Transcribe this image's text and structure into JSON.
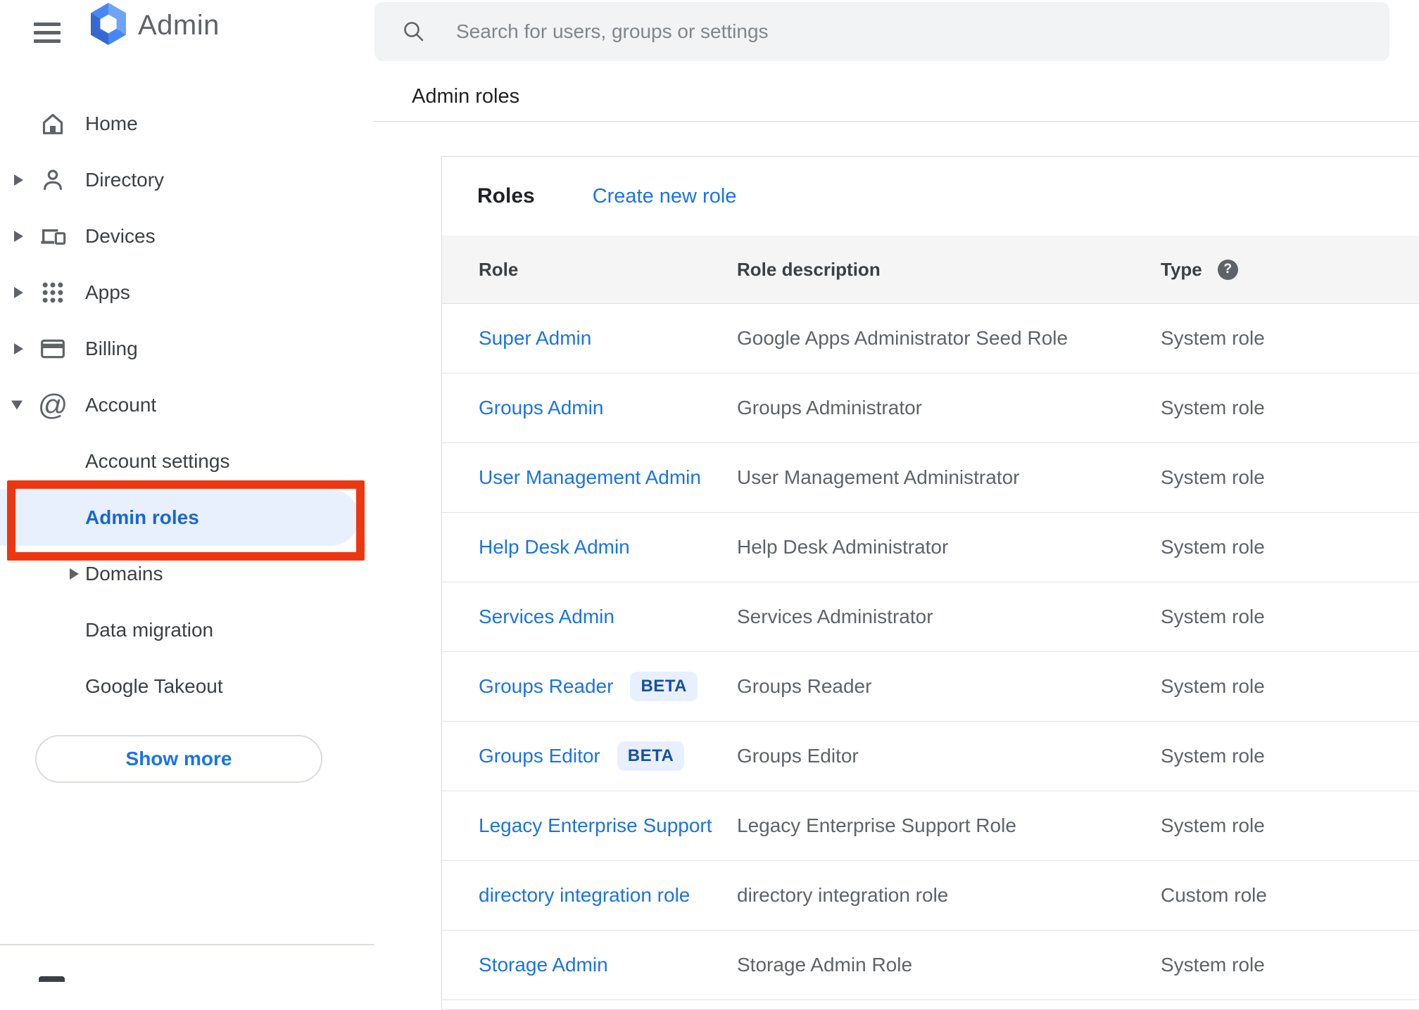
{
  "app": {
    "product_name": "Admin"
  },
  "search": {
    "placeholder": "Search for users, groups or settings"
  },
  "breadcrumb": {
    "label": "Admin roles"
  },
  "sidebar": {
    "items": [
      {
        "label": "Home",
        "icon": "home",
        "arrow": "none",
        "level": 0,
        "active": false
      },
      {
        "label": "Directory",
        "icon": "person",
        "arrow": "right",
        "level": 0,
        "active": false
      },
      {
        "label": "Devices",
        "icon": "devices",
        "arrow": "right",
        "level": 0,
        "active": false
      },
      {
        "label": "Apps",
        "icon": "apps",
        "arrow": "right",
        "level": 0,
        "active": false
      },
      {
        "label": "Billing",
        "icon": "card",
        "arrow": "right",
        "level": 0,
        "active": false
      },
      {
        "label": "Account",
        "icon": "at",
        "arrow": "down",
        "level": 0,
        "active": false
      },
      {
        "label": "Account settings",
        "icon": "",
        "arrow": "none",
        "level": 1,
        "active": false
      },
      {
        "label": "Admin roles",
        "icon": "",
        "arrow": "none",
        "level": 1,
        "active": true
      },
      {
        "label": "Domains",
        "icon": "",
        "arrow": "right-indented",
        "level": 1,
        "active": false
      },
      {
        "label": "Data migration",
        "icon": "",
        "arrow": "none",
        "level": 1,
        "active": false
      },
      {
        "label": "Google Takeout",
        "icon": "",
        "arrow": "none",
        "level": 1,
        "active": false
      }
    ],
    "show_more_label": "Show more"
  },
  "card": {
    "title": "Roles",
    "create_label": "Create new role",
    "columns": {
      "role": "Role",
      "description": "Role description",
      "type": "Type"
    },
    "help_glyph": "?",
    "rows": [
      {
        "role": "Super Admin",
        "badge": "",
        "description": "Google Apps Administrator Seed Role",
        "type": "System role"
      },
      {
        "role": "Groups Admin",
        "badge": "",
        "description": "Groups Administrator",
        "type": "System role"
      },
      {
        "role": "User Management Admin",
        "badge": "",
        "description": "User Management Administrator",
        "type": "System role"
      },
      {
        "role": "Help Desk Admin",
        "badge": "",
        "description": "Help Desk Administrator",
        "type": "System role"
      },
      {
        "role": "Services Admin",
        "badge": "",
        "description": "Services Administrator",
        "type": "System role"
      },
      {
        "role": "Groups Reader",
        "badge": "BETA",
        "description": "Groups Reader",
        "type": "System role"
      },
      {
        "role": "Groups Editor",
        "badge": "BETA",
        "description": "Groups Editor",
        "type": "System role"
      },
      {
        "role": "Legacy Enterprise Support",
        "badge": "",
        "description": "Legacy Enterprise Support Role",
        "type": "System role"
      },
      {
        "role": "directory integration role",
        "badge": "",
        "description": "directory integration role",
        "type": "Custom role"
      },
      {
        "role": "Storage Admin",
        "badge": "",
        "description": "Storage Admin Role",
        "type": "System role"
      }
    ]
  },
  "annotation": {
    "highlighted_item": "Admin roles",
    "shape": "red-box"
  },
  "colors": {
    "accent_blue": "#1a73e8",
    "active_item_text": "#1967d2",
    "active_item_bg": "#e8f0fe",
    "annotation_red": "#ee3711",
    "search_bg": "#f1f3f4",
    "table_header_bg": "#f5f5f5",
    "beta_badge_bg": "#e8f0fe",
    "beta_badge_text": "#174ea6",
    "muted_text": "#5f6368",
    "border": "#dadce0"
  }
}
